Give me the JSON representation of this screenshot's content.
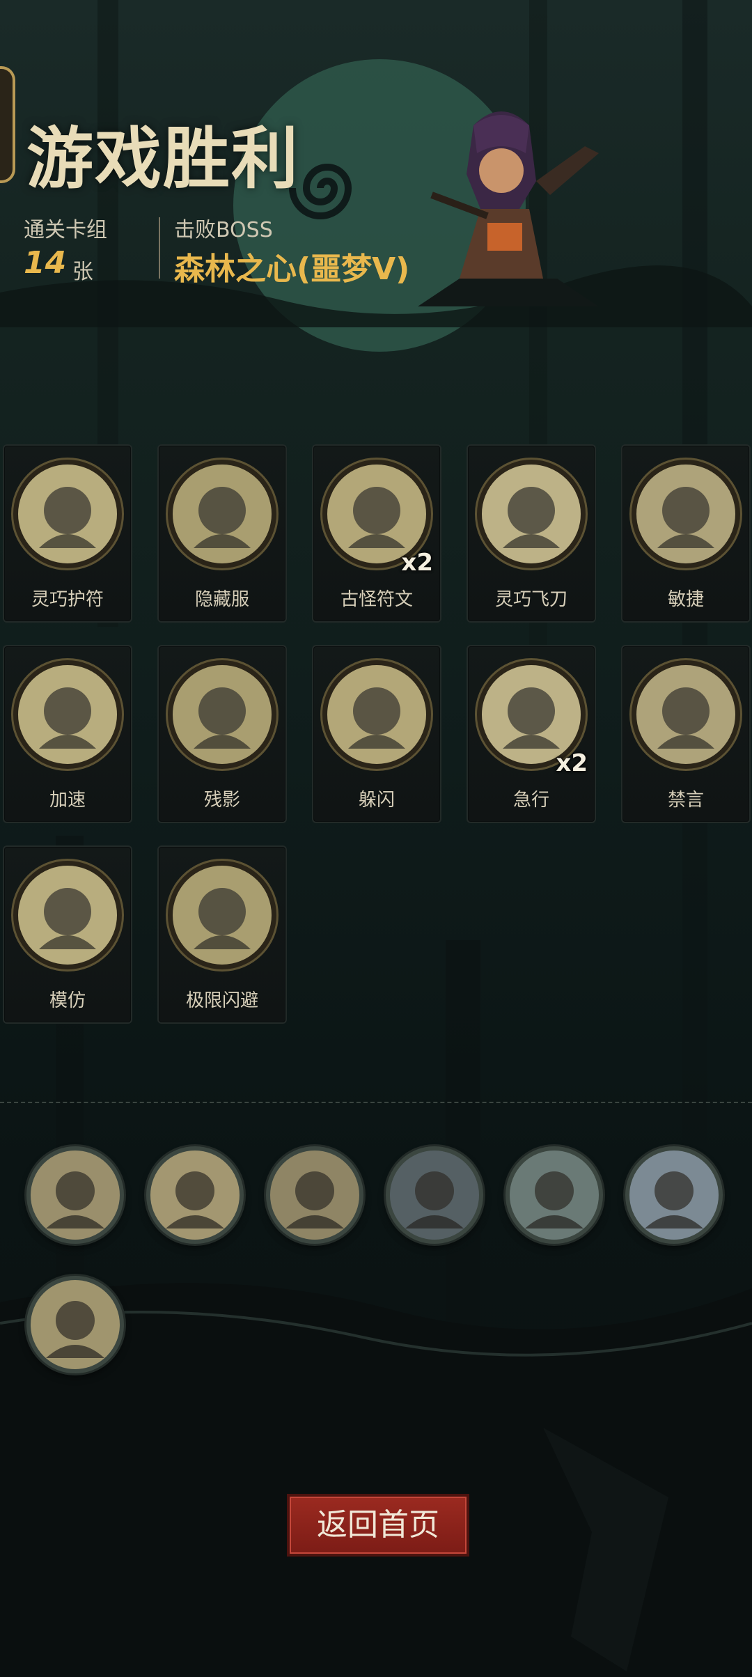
{
  "header": {
    "title": "游戏胜利",
    "deck_label": "通关卡组",
    "deck_count": "14",
    "deck_unit": "张",
    "boss_label": "击败BOSS",
    "boss_name": "森林之心(噩梦V)"
  },
  "cards": [
    {
      "name": "灵巧护符",
      "count": ""
    },
    {
      "name": "隐藏服",
      "count": ""
    },
    {
      "name": "古怪符文",
      "count": "x2"
    },
    {
      "name": "灵巧飞刀",
      "count": ""
    },
    {
      "name": "敏捷",
      "count": ""
    },
    {
      "name": "加速",
      "count": ""
    },
    {
      "name": "残影",
      "count": ""
    },
    {
      "name": "躲闪",
      "count": ""
    },
    {
      "name": "急行",
      "count": "x2"
    },
    {
      "name": "禁言",
      "count": ""
    },
    {
      "name": "模仿",
      "count": ""
    },
    {
      "name": "极限闪避",
      "count": ""
    }
  ],
  "relic_icons": [
    "hooded-lightning-icon",
    "horned-skull-icon",
    "vampire-icon",
    "book-sword-icon",
    "goblin-warrior-icon",
    "blade-icon",
    "archer-icon"
  ],
  "actions": {
    "return_label": "返回首页"
  },
  "colors": {
    "accent_gold": "#e9b84d",
    "button_red": "#8b231b"
  }
}
